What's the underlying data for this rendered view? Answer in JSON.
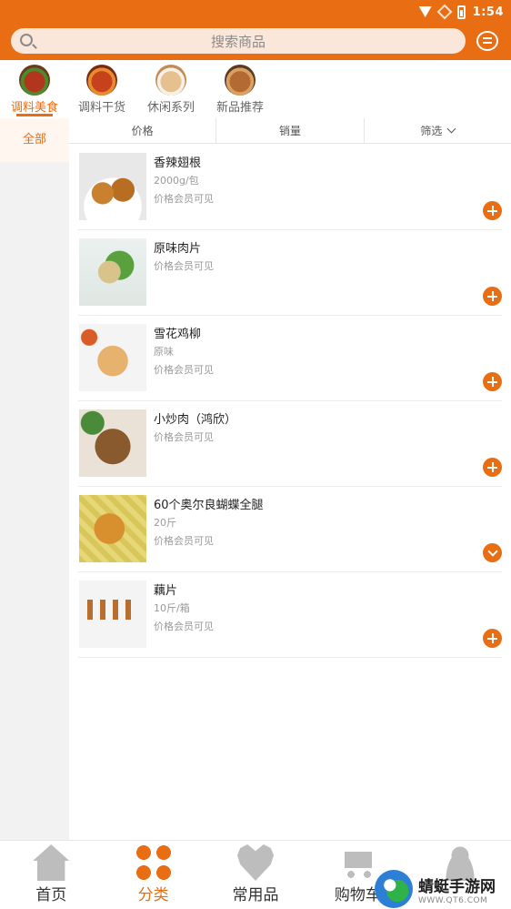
{
  "status_bar": {
    "time": "1:54"
  },
  "search": {
    "placeholder": "搜索商品"
  },
  "categories": [
    {
      "label": "调料美食",
      "active": true
    },
    {
      "label": "调料干货",
      "active": false
    },
    {
      "label": "休闲系列",
      "active": false
    },
    {
      "label": "新品推荐",
      "active": false
    }
  ],
  "sidebar": {
    "items": [
      {
        "label": "全部",
        "active": true
      }
    ]
  },
  "sort_bar": {
    "price": "价格",
    "sales": "销量",
    "filter": "筛选"
  },
  "products": [
    {
      "name": "香辣翅根",
      "spec": "2000g/包",
      "price": "价格会员可见",
      "action": "add"
    },
    {
      "name": "原味肉片",
      "spec": "",
      "price": "价格会员可见",
      "action": "add"
    },
    {
      "name": "雪花鸡柳",
      "spec": "原味",
      "price": "价格会员可见",
      "action": "add"
    },
    {
      "name": "小炒肉（鸿欣）",
      "spec": "",
      "price": "价格会员可见",
      "action": "add"
    },
    {
      "name": "60个奥尔良蝴蝶全腿",
      "spec": "20斤",
      "price": "价格会员可见",
      "action": "expand"
    },
    {
      "name": "藕片",
      "spec": "10斤/箱",
      "price": "价格会员可见",
      "action": "add"
    }
  ],
  "bottom_nav": [
    {
      "label": "首页",
      "icon": "home-icon",
      "active": false
    },
    {
      "label": "分类",
      "icon": "grid-icon",
      "active": true
    },
    {
      "label": "常用品",
      "icon": "heart-icon",
      "active": false
    },
    {
      "label": "购物车",
      "icon": "cart-icon",
      "active": false
    },
    {
      "label": "",
      "icon": "user-icon",
      "active": false
    }
  ],
  "watermark": {
    "title": "蜻蜓手游网",
    "site": "WWW.QT6.COM"
  },
  "colors": {
    "brand": "#e86d13",
    "search_bg": "#fbe7d9",
    "sidebar_bg": "#f2f2f2"
  }
}
